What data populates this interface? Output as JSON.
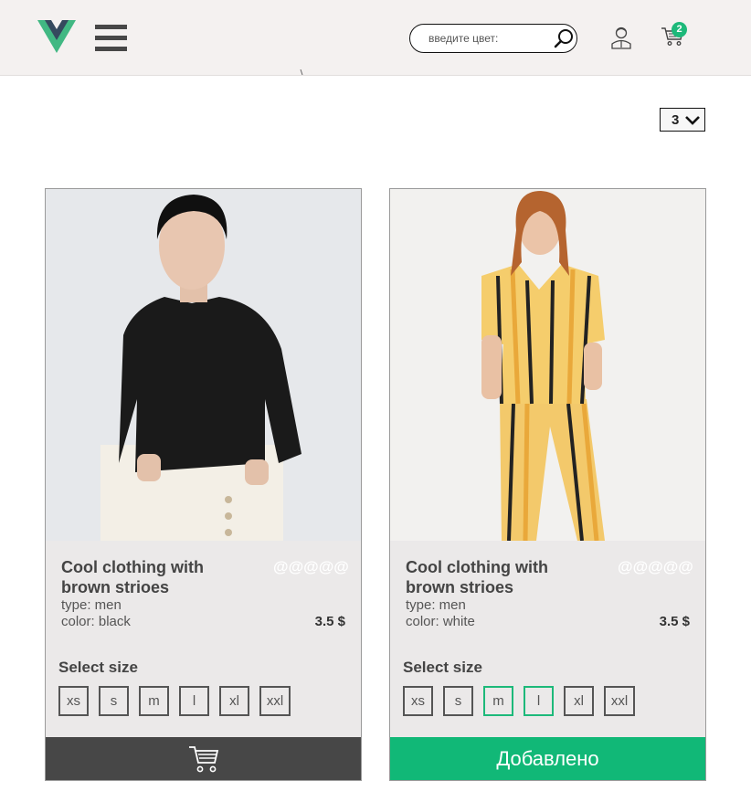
{
  "header": {
    "logo_icon": "vue-logo-icon",
    "menu_icon": "hamburger-menu-icon",
    "search": {
      "placeholder": "введите цвет:",
      "value": "",
      "icon": "search-icon"
    },
    "user_icon": "user-icon",
    "cart": {
      "icon": "cart-icon",
      "count": "2"
    }
  },
  "toolbar": {
    "per_page": "3",
    "per_page_icon": "chevron-down-icon"
  },
  "products": [
    {
      "title": "Cool clothing with brown strioes",
      "rating": "@@@@@",
      "type": "type: men",
      "color": "color: black",
      "price": "3.5 $",
      "select_size_label": "Select size",
      "sizes": [
        "xs",
        "s",
        "m",
        "l",
        "xl",
        "xxl"
      ],
      "selected_sizes": [],
      "cart_button": {
        "icon": "cart-icon",
        "label": ""
      }
    },
    {
      "title": "Cool clothing with brown strioes",
      "rating": "@@@@@",
      "type": "type: men",
      "color": "color: white",
      "price": "3.5 $",
      "select_size_label": "Select size",
      "sizes": [
        "xs",
        "s",
        "m",
        "l",
        "xl",
        "xxl"
      ],
      "selected_sizes": [
        "m",
        "l"
      ],
      "cart_button": {
        "icon": "",
        "label": "Добавлено"
      }
    }
  ],
  "colors": {
    "header_bg": "#f4f1f0",
    "accent_green": "#11b877",
    "dark_button": "#474747",
    "card_bg": "#ebe9e9"
  }
}
